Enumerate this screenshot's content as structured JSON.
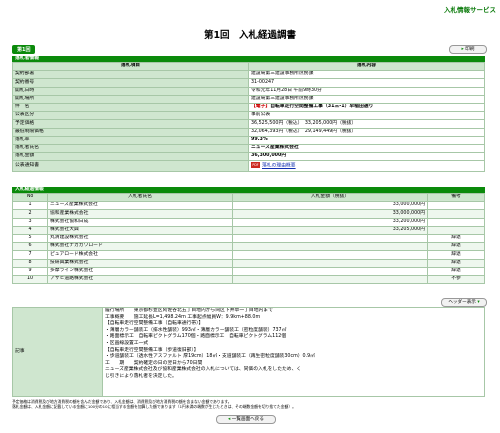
{
  "header": {
    "service_name": "入札情報サービス",
    "page_title": "第1回　入札経過調書",
    "round_tab": "第1回",
    "print_button": "印刷"
  },
  "info_section": {
    "title": "落札者情報",
    "col_item": "落札項目",
    "col_content": "落札内容",
    "rows": {
      "dept_k": "契約部署",
      "dept_v": "建設局第三建設事務所庶務課",
      "no_k": "契約番号",
      "no_v": "31-00247",
      "date_k": "開札日時",
      "date_v": "令和元年11月28日 午前9時30分",
      "place_k": "開札場所",
      "place_v": "建設局第三建設事務所庶務課",
      "name_k": "件　名",
      "name_badge": "【電子】",
      "name_v": "自転車走行空間整備工事（31三-1）早稲田通り",
      "type_k": "公表区分",
      "type_v": "事前公表",
      "est_k": "予定価格",
      "est_v": "36,525,500円（税込）　33,205,000円（税抜）",
      "min_k": "最低制限価格",
      "min_v": "32,064,393円（税込）　29,149,449円（税抜）",
      "rate_k": "落札率",
      "rate_v": "99.3%",
      "winner_k": "落札者氏名",
      "winner_v": "ニューズ産業株式会社",
      "amount_k": "落札金額",
      "amount_v": "36,300,000円",
      "notice_k": "公表通知書",
      "notice_icon": "PDF",
      "notice_link": "落札の理由概要"
    }
  },
  "bid_section": {
    "title": "入札経過情報",
    "headers": {
      "no": "No",
      "name": "入札者氏名",
      "amount": "入札金額（税抜）",
      "note": "備考"
    },
    "rows": [
      {
        "no": "1",
        "name": "ニューズ産業株式会社",
        "amount": "33,000,000円",
        "note": ""
      },
      {
        "no": "2",
        "name": "協和産業株式会社",
        "amount": "33,000,000円",
        "note": ""
      },
      {
        "no": "3",
        "name": "株式会社協和日成",
        "amount": "33,200,000円",
        "note": ""
      },
      {
        "no": "4",
        "name": "株式会社大興",
        "amount": "33,205,000円",
        "note": ""
      },
      {
        "no": "5",
        "name": "丸清建設株式会社",
        "amount": "",
        "note": "辞退"
      },
      {
        "no": "6",
        "name": "株式会社ナカガワロード",
        "amount": "",
        "note": "辞退"
      },
      {
        "no": "7",
        "name": "ピュアロード株式会社",
        "amount": "",
        "note": "辞退"
      },
      {
        "no": "8",
        "name": "技研興業株式会社",
        "amount": "",
        "note": "辞退"
      },
      {
        "no": "9",
        "name": "多摩ライン株式会社",
        "amount": "",
        "note": "辞退"
      },
      {
        "no": "10",
        "name": "アサヒ道路株式会社",
        "amount": "",
        "note": "不参"
      }
    ]
  },
  "header_button": "ヘッダー表示",
  "remarks": {
    "label": "記事",
    "lines": [
      "履行場所　　東京都杉並区阿佐谷北五丁目地内から同区下井草一丁目地内まで",
      "工事概要　　施工延長L=1,498.24ｍ 工事起点幅員W：9.9km+88.0m",
      "【自転車走行空間整備工事（自転車通行帯）】",
      "・薄層カラー舗装工（排水性舗装）993㎡・薄層カラー舗装工（密粒度舗装）737㎡",
      "・路面標示工　自転車ピクトグラム170個・路面標示工　自転車ピクトグラム112個",
      "・区画線設置工一式",
      "【自転車走行空間整備工事（歩道復旧部）】",
      "・歩道舗装工（透水性アスファルト 厚19cm）18㎡・支道舗装工（再生密粒度舗装30cm）0.9㎡",
      "工　　期　　契約確定の日の翌日から70日間",
      "ニューズ産業株式会社及び協和産業株式会社の入札については、同価の入札をしたため、く",
      "じ引きにより落札者を決定した。"
    ]
  },
  "footnotes": [
    "予定価格は消費税及び地方消費税の額を含んだ金額であり、入札金額は、消費税及び地方消費税の額を含まない金額であります。",
    "落札金額は、入札金額に記載している金額に100分の10に相当する金額を加算した額であります（1円未満の端数が生じたときは、その端数金額を切り捨てた金額）。"
  ],
  "back_button": "一覧画面へ戻る"
}
